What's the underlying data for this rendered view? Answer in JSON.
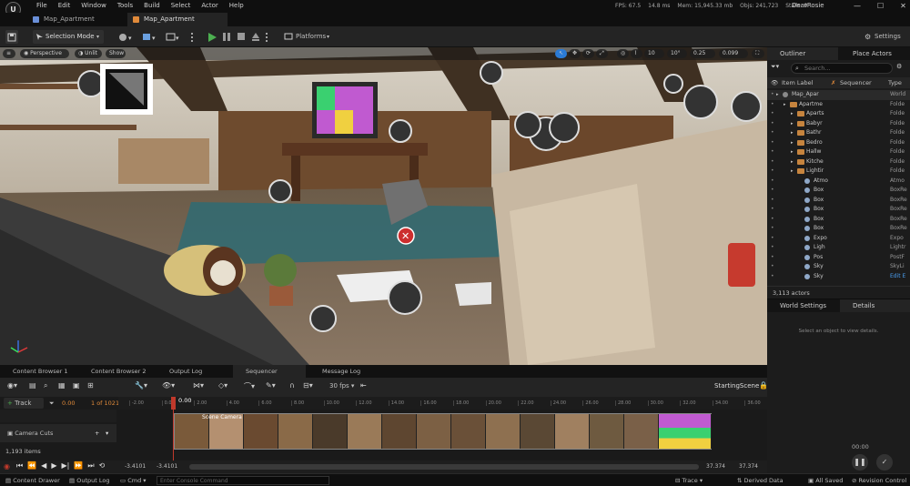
{
  "menubar": {
    "logo": "U",
    "menus": [
      "File",
      "Edit",
      "Window",
      "Tools",
      "Build",
      "Select",
      "Actor",
      "Help"
    ],
    "stats": {
      "fps": "FPS: 67.5",
      "ms": "14.8 ms",
      "mem": "Mem: 15,945.33 mb",
      "objs": "Objs: 241,723",
      "stalls": "Stalls: 9"
    },
    "user": "DearRosie",
    "win_min": "—",
    "win_max": "☐",
    "win_close": "✕"
  },
  "tabs": [
    {
      "label": "Map_Apartment",
      "active": false
    },
    {
      "label": "Map_Apartment",
      "active": true
    }
  ],
  "toolbar": {
    "selection_mode": "Selection Mode",
    "platforms": "Platforms",
    "settings": "Settings"
  },
  "viewport": {
    "perspective": "Perspective",
    "lit": "Unlit",
    "show": "Show",
    "grid": "10",
    "angle": "10°",
    "scale": "0.25",
    "speed": "0.099",
    "speed_icon": "4"
  },
  "outliner": {
    "tab": "Outliner",
    "place_tab": "Place Actors",
    "search_placeholder": "Search...",
    "col_label": "Item Label",
    "col_seq": "Sequencer",
    "col_type": "Type",
    "rows": [
      {
        "label": "Map_Apar",
        "type": "World",
        "kind": "world",
        "indent": 0
      },
      {
        "label": "Apartme",
        "type": "Folde",
        "kind": "folder",
        "indent": 1
      },
      {
        "label": "Aparts",
        "type": "Folde",
        "kind": "folder",
        "indent": 2
      },
      {
        "label": "Babyr",
        "type": "Folde",
        "kind": "folder",
        "indent": 2
      },
      {
        "label": "Bathr",
        "type": "Folde",
        "kind": "folder",
        "indent": 2
      },
      {
        "label": "Bedro",
        "type": "Folde",
        "kind": "folder",
        "indent": 2
      },
      {
        "label": "Hallw",
        "type": "Folde",
        "kind": "folder",
        "indent": 2
      },
      {
        "label": "Kitche",
        "type": "Folde",
        "kind": "folder",
        "indent": 2
      },
      {
        "label": "Lightir",
        "type": "Folde",
        "kind": "folder",
        "indent": 2
      },
      {
        "label": "Atmo",
        "type": "Atmo",
        "kind": "actor",
        "indent": 3
      },
      {
        "label": "Box",
        "type": "BoxRe",
        "kind": "actor",
        "indent": 3
      },
      {
        "label": "Box",
        "type": "BoxRe",
        "kind": "actor",
        "indent": 3
      },
      {
        "label": "Box",
        "type": "BoxRe",
        "kind": "actor",
        "indent": 3
      },
      {
        "label": "Box",
        "type": "BoxRe",
        "kind": "actor",
        "indent": 3
      },
      {
        "label": "Box",
        "type": "BoxRe",
        "kind": "actor",
        "indent": 3
      },
      {
        "label": "Expo",
        "type": "Expo",
        "kind": "actor",
        "indent": 3
      },
      {
        "label": "Ligh",
        "type": "Lightr",
        "kind": "actor",
        "indent": 3
      },
      {
        "label": "Pos",
        "type": "PostF",
        "kind": "actor",
        "indent": 3
      },
      {
        "label": "Sky",
        "type": "SkyLi",
        "kind": "actor",
        "indent": 3
      },
      {
        "label": "Sky",
        "type": "Edit E",
        "kind": "actor",
        "indent": 3
      }
    ],
    "count": "3,113 actors"
  },
  "details": {
    "world_tab": "World Settings",
    "details_tab": "Details",
    "empty": "Select an object to view details.",
    "timecode": "00:00"
  },
  "bottom_tabs": [
    "Content Browser 1",
    "Content Browser 2",
    "Output Log",
    "Sequencer",
    "Message Log"
  ],
  "sequencer": {
    "fps": "30 fps",
    "scene": "StartingScene",
    "track": "Track",
    "time": "0.00",
    "frame": "1 of 1021",
    "cursor": "0.00",
    "ticks": [
      "-2.00",
      "0.00",
      "2.00",
      "4.00",
      "6.00",
      "8.00",
      "10.00",
      "12.00",
      "14.00",
      "16.00",
      "18.00",
      "20.00",
      "22.00",
      "24.00",
      "26.00",
      "28.00",
      "30.00",
      "32.00",
      "34.00",
      "36.00"
    ],
    "camera_cuts": "Camera Cuts",
    "items": "1,193 items",
    "start1": "-3.4101",
    "start2": "-3.4101",
    "end1": "37.374",
    "end2": "37.374",
    "shot": "Scene Camera"
  },
  "statusbar": {
    "content_drawer": "Content Drawer",
    "output_log": "Output Log",
    "cmd": "Cmd",
    "console_placeholder": "Enter Console Command",
    "trace": "Trace",
    "derived": "Derived Data",
    "saved": "All Saved",
    "revision": "Revision Control"
  },
  "colors": {
    "accent": "#2b7bd6",
    "play": "#4caf50",
    "playhead": "#c0392b",
    "bg": "#151515"
  }
}
